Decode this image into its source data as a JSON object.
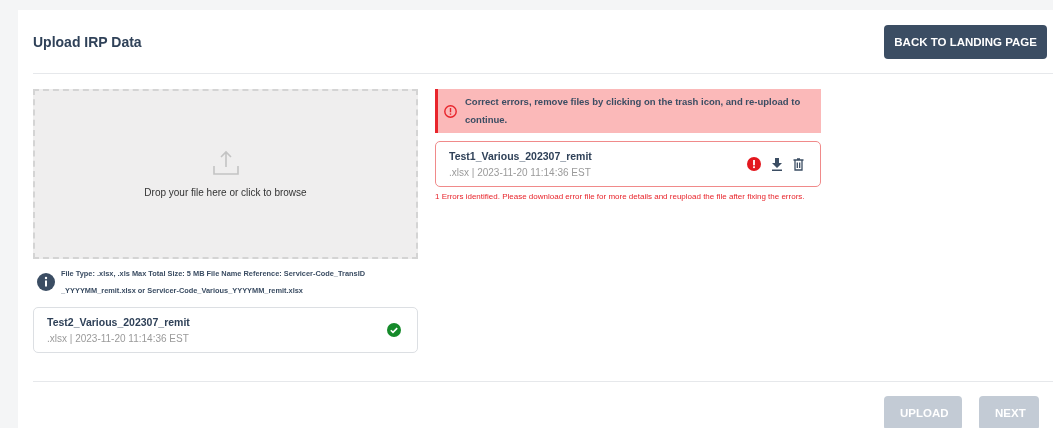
{
  "header": {
    "title": "Upload IRP Data",
    "back_button": "BACK TO LANDING PAGE"
  },
  "dropzone": {
    "text": "Drop your file here or click to browse"
  },
  "info": {
    "text": "File Type: .xlsx, .xls Max Total Size: 5 MB File Name Reference: Servicer-Code_TransID _YYYYMM_remit.xlsx or Servicer-Code_Various_YYYYMM_remit.xlsx"
  },
  "left_files": [
    {
      "name": "Test2_Various_202307_remit",
      "meta": ".xlsx | 2023-11-20 11:14:36 EST",
      "kind": "success"
    }
  ],
  "alert": {
    "text": "Correct errors, remove files by clicking on the trash icon, and re-upload to continue."
  },
  "right_files": [
    {
      "name": "Test1_Various_202307_remit",
      "meta": ".xlsx | 2023-11-20 11:14:36 EST",
      "kind": "error",
      "error_message": "1 Errors identified. Please download error file for more details and reupload the file after fixing the errors."
    }
  ],
  "footer_buttons": [
    {
      "label": "UPLOAD",
      "disabled": true
    },
    {
      "label": "NEXT",
      "disabled": true
    }
  ]
}
